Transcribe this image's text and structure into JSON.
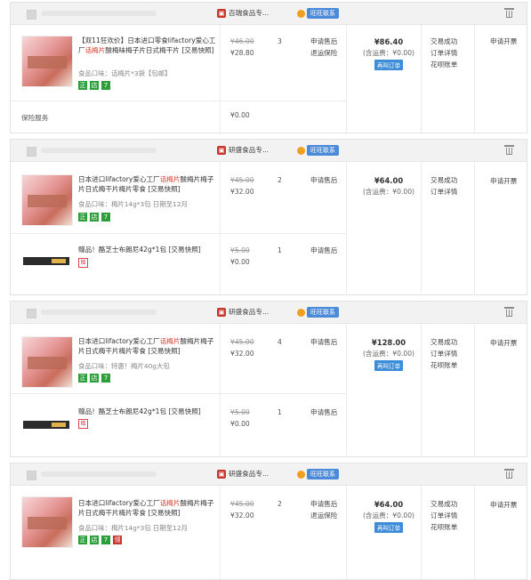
{
  "labels": {
    "contact": "旺旺联系",
    "service_after": "申请售后",
    "service_return": "退运保险",
    "pay_link": "再叫订单",
    "status_success": "交易成功",
    "status_detail": "订单详情",
    "status_snapshot": "花呗账单",
    "action_refund": "申请开票",
    "insurance_label": "保险服务",
    "insurance_value": "¥0.00",
    "tag_zheng": "正",
    "tag_shop": "店",
    "tag_seven": "7",
    "tag_gift": "赠",
    "tag_ling": "领"
  },
  "orders": [
    {
      "shop": "百瑞食品专...",
      "items": [
        {
          "title_pre": "【双11狂欢价】日本进口零食lifactory爱心工厂",
          "title_hl": "话梅片",
          "title_post": "酸梅味梅子片日式梅干片 [交易快照]",
          "attr": "食品口味：话梅片*3袋【包邮】",
          "old_price": "¥46.00",
          "price": "¥28.80",
          "qty": "3"
        }
      ],
      "total": "¥86.40",
      "shipping": "(含运费：¥0.00)"
    },
    {
      "shop": "研盛食品专...",
      "items": [
        {
          "title_pre": "日本进口lifactory爱心工厂",
          "title_hl": "话梅片",
          "title_post": "酸梅片梅子片日式梅干片梅片零食 [交易快照]",
          "attr": "食品口味：梅片14g*3包 日期至12月",
          "old_price": "¥45.00",
          "price": "¥32.00",
          "qty": "2"
        },
        {
          "title": "赠品！酪芝士布朗尼42g*1包 [交易快照]",
          "old_price": "¥5.00",
          "price": "¥0.00",
          "qty": "1"
        }
      ],
      "total": "¥64.00",
      "shipping": "(含运费：¥0.00)"
    },
    {
      "shop": "研盛食品专...",
      "items": [
        {
          "title_pre": "日本进口lifactory爱心工厂",
          "title_hl": "话梅片",
          "title_post": "酸梅片梅子片日式梅干片梅片零食 [交易快照]",
          "attr": "食品口味：特惠！梅片40g大包",
          "old_price": "¥45.00",
          "price": "¥32.00",
          "qty": "4"
        },
        {
          "title": "赠品！酪芝士布朗尼42g*1包 [交易快照]",
          "old_price": "¥5.00",
          "price": "¥0.00",
          "qty": "1"
        }
      ],
      "total": "¥128.00",
      "shipping": "(含运费：¥0.00)"
    },
    {
      "shop": "研盛食品专...",
      "items": [
        {
          "title_pre": "日本进口lifactory爱心工厂",
          "title_hl": "话梅片",
          "title_post": "酸梅片梅子片日式梅干片梅片零食 [交易快照]",
          "attr": "食品口味：梅片14g*3包 日期至12月",
          "old_price": "¥45.00",
          "price": "¥32.00",
          "qty": "2"
        }
      ],
      "total": "¥64.00",
      "shipping": "(含运费：¥0.00)"
    }
  ]
}
